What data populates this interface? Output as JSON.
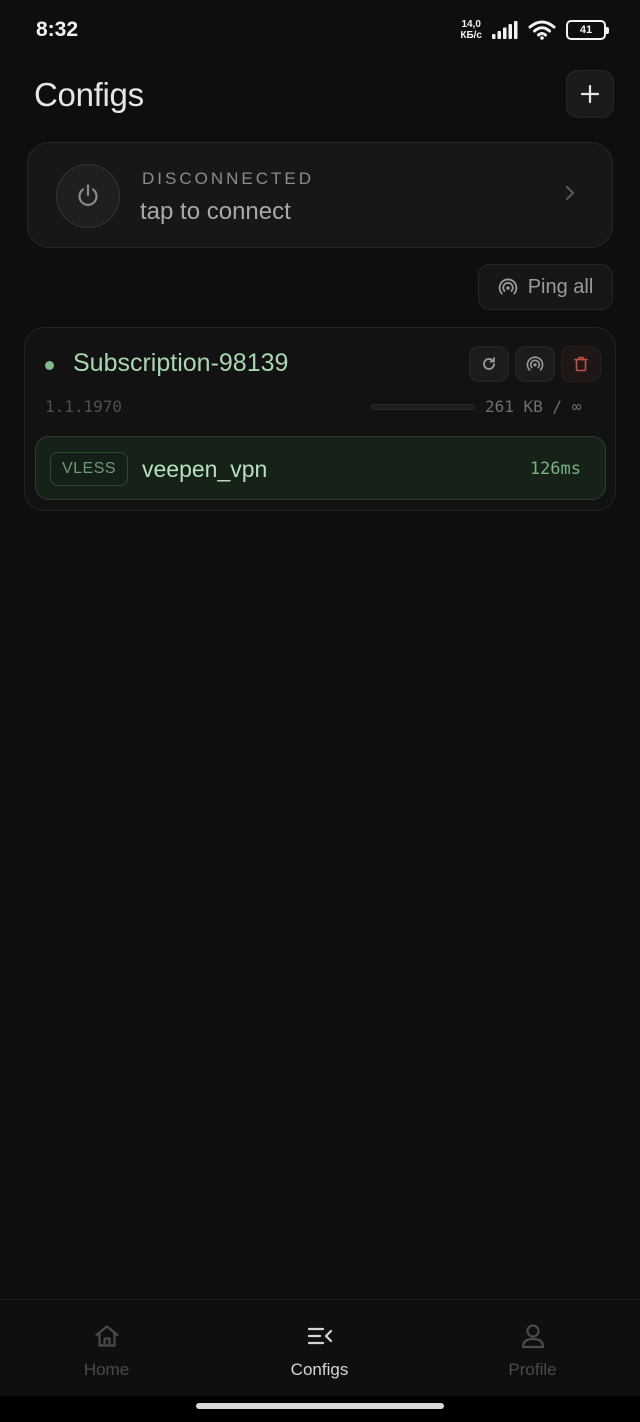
{
  "status_bar": {
    "time": "8:32",
    "net_speed_value": "14,0",
    "net_speed_unit": "КБ/с",
    "battery": "41"
  },
  "header": {
    "title": "Configs",
    "add_icon": "plus-icon"
  },
  "connect_card": {
    "status": "DISCONNECTED",
    "hint": "tap to connect",
    "power_icon": "power-icon",
    "chevron_icon": "chevron-right-icon"
  },
  "ping_all": {
    "label": "Ping all",
    "icon": "broadcast-icon"
  },
  "subscription": {
    "name": "Subscription-98139",
    "date": "1.1.1970",
    "usage_text": "261 KB / ∞",
    "usage_fraction": 0.0,
    "actions": [
      "refresh-icon",
      "broadcast-icon",
      "trash-icon"
    ],
    "server": {
      "protocol": "VLESS",
      "name": "veepen_vpn",
      "ping": "126ms"
    }
  },
  "nav": {
    "items": [
      {
        "label": "Home",
        "icon": "home-icon",
        "active": false
      },
      {
        "label": "Configs",
        "icon": "list-icon",
        "active": true
      },
      {
        "label": "Profile",
        "icon": "user-icon",
        "active": false
      }
    ]
  },
  "colors": {
    "background": "#0e0e0e",
    "accent_green": "#a9d6b0",
    "danger_red": "#c0504a"
  }
}
